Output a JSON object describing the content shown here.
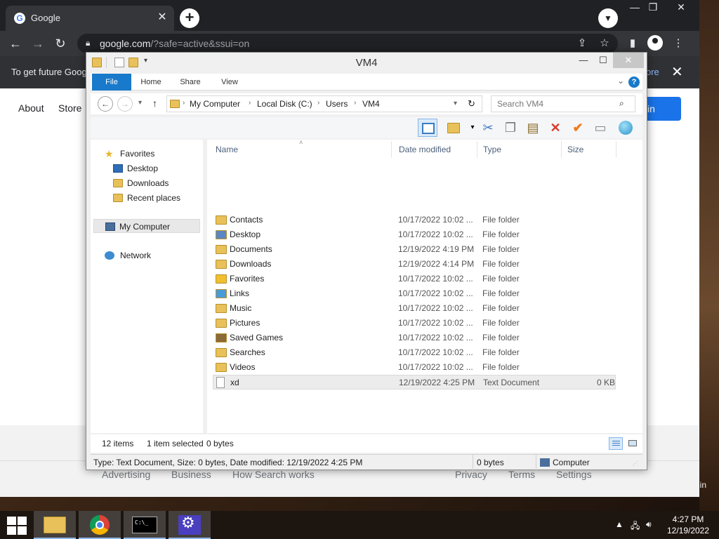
{
  "browser": {
    "tab_title": "Google",
    "tab_favicon": "G",
    "url_host": "google.com",
    "url_rest": "/?safe=active&ssui=on",
    "infobar_text": "To get future Goog",
    "infobar_more": "ore",
    "google_links": [
      "About",
      "Store"
    ],
    "signin_label": "in",
    "footer_links": {
      "advertising": "Advertising",
      "business": "Business",
      "how_search_works": "How Search works",
      "privacy": "Privacy",
      "terms": "Terms",
      "settings": "Settings"
    }
  },
  "explorer": {
    "title": "VM4",
    "ribbon_tabs": [
      "File",
      "Home",
      "Share",
      "View"
    ],
    "breadcrumb": [
      "My Computer",
      "Local Disk (C:)",
      "Users",
      "VM4"
    ],
    "search_placeholder": "Search VM4",
    "nav": {
      "favorites": "Favorites",
      "desktop": "Desktop",
      "downloads": "Downloads",
      "recent_places": "Recent places",
      "my_computer": "My Computer",
      "network": "Network"
    },
    "columns": [
      "Name",
      "Date modified",
      "Type",
      "Size"
    ],
    "files": [
      {
        "name": "Contacts",
        "date": "10/17/2022 10:02 ...",
        "type": "File folder",
        "size": "",
        "icon": "contacts-folder-icon"
      },
      {
        "name": "Desktop",
        "date": "10/17/2022 10:02 ...",
        "type": "File folder",
        "size": "",
        "icon": "desktop-folder-icon"
      },
      {
        "name": "Documents",
        "date": "12/19/2022 4:19 PM",
        "type": "File folder",
        "size": "",
        "icon": "documents-folder-icon"
      },
      {
        "name": "Downloads",
        "date": "12/19/2022 4:14 PM",
        "type": "File folder",
        "size": "",
        "icon": "downloads-folder-icon"
      },
      {
        "name": "Favorites",
        "date": "10/17/2022 10:02 ...",
        "type": "File folder",
        "size": "",
        "icon": "favorites-folder-icon"
      },
      {
        "name": "Links",
        "date": "10/17/2022 10:02 ...",
        "type": "File folder",
        "size": "",
        "icon": "links-folder-icon"
      },
      {
        "name": "Music",
        "date": "10/17/2022 10:02 ...",
        "type": "File folder",
        "size": "",
        "icon": "music-folder-icon"
      },
      {
        "name": "Pictures",
        "date": "10/17/2022 10:02 ...",
        "type": "File folder",
        "size": "",
        "icon": "pictures-folder-icon"
      },
      {
        "name": "Saved Games",
        "date": "10/17/2022 10:02 ...",
        "type": "File folder",
        "size": "",
        "icon": "saved-games-folder-icon"
      },
      {
        "name": "Searches",
        "date": "10/17/2022 10:02 ...",
        "type": "File folder",
        "size": "",
        "icon": "searches-folder-icon"
      },
      {
        "name": "Videos",
        "date": "10/17/2022 10:02 ...",
        "type": "File folder",
        "size": "",
        "icon": "videos-folder-icon"
      },
      {
        "name": "xd",
        "date": "12/19/2022 4:25 PM",
        "type": "Text Document",
        "size": "0 KB",
        "icon": "text-file-icon",
        "selected": true
      }
    ],
    "status": {
      "item_count": "12 items",
      "selection": "1 item selected",
      "selection_size": "0 bytes"
    },
    "details": {
      "summary": "Type: Text Document, Size: 0 bytes, Date modified: 12/19/2022 4:25 PM",
      "size": "0 bytes",
      "location": "Computer"
    }
  },
  "taskbar": {
    "time": "4:27 PM",
    "date": "12/19/2022",
    "corner_text": "in"
  },
  "colors": {
    "accent": "#1979ca",
    "folder": "#e8c15a",
    "chrome_dark": "#202124"
  }
}
